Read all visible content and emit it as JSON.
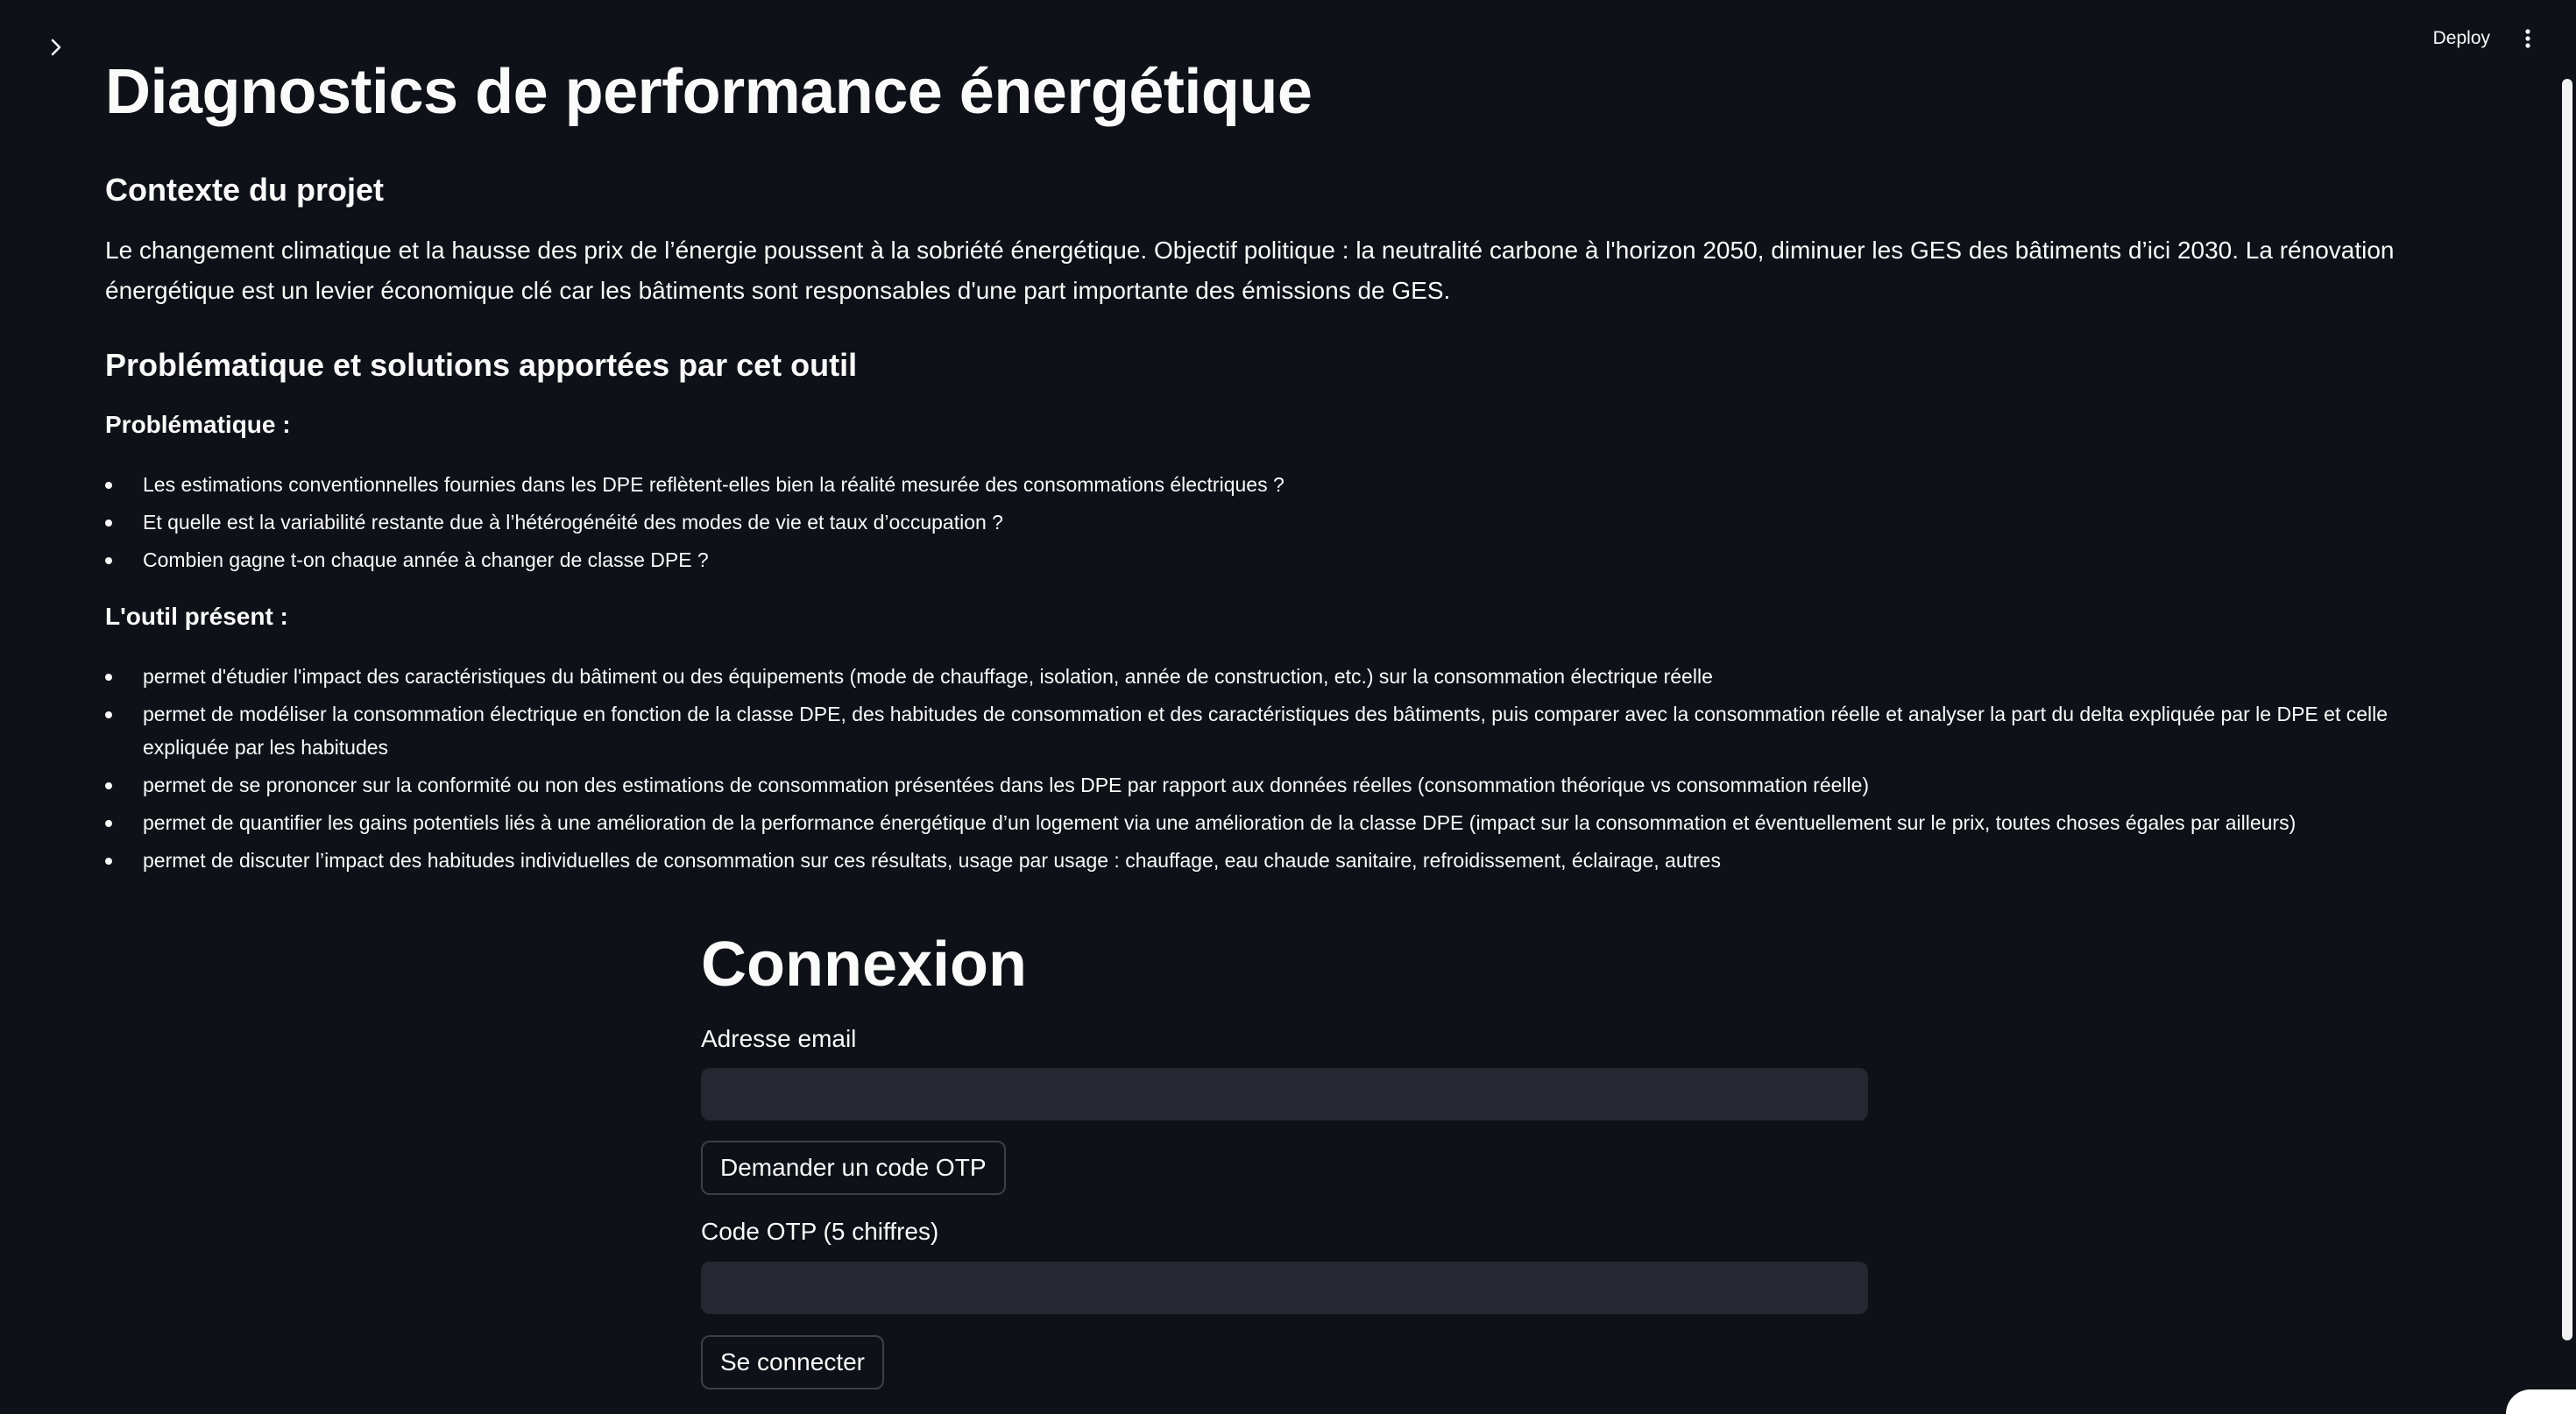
{
  "header": {
    "deploy_label": "Deploy"
  },
  "page": {
    "title": "Diagnostics de performance énergétique"
  },
  "context": {
    "heading": "Contexte du projet",
    "paragraph": "Le changement climatique et la hausse des prix de l’énergie poussent à la sobriété énergétique. Objectif politique : la neutralité carbone à l'horizon 2050, diminuer les GES des bâtiments d’ici 2030. La rénovation énergétique est un levier économique clé car les bâtiments sont responsables d'une part importante des émissions de GES."
  },
  "problem": {
    "heading": "Problématique et solutions apportées par cet outil",
    "label": "Problématique :",
    "items": [
      "Les estimations conventionnelles fournies dans les DPE reflètent-elles bien la réalité mesurée des consommations électriques ?",
      "Et quelle est la variabilité restante due à l’hétérogénéité des modes de vie et taux d’occupation ?",
      "Combien gagne t-on chaque année à changer de classe DPE ?"
    ]
  },
  "tool": {
    "label": "L'outil présent :",
    "items": [
      "permet d'étudier l'impact des caractéristiques du bâtiment ou des équipements (mode de chauffage, isolation, année de construction, etc.) sur la consommation électrique réelle",
      "permet de modéliser la consommation électrique en fonction de la classe DPE, des habitudes de consommation et des caractéristiques des bâtiments, puis comparer avec la consommation réelle et analyser la part du delta expliquée par le DPE et celle expliquée par les habitudes",
      "permet de se prononcer sur la conformité ou non des estimations de consommation présentées dans les DPE par rapport aux données réelles (consommation théorique vs consommation réelle)",
      "permet de quantifier les gains potentiels liés à une amélioration de la performance énergétique d’un logement via une amélioration de la classe DPE (impact sur la consommation et éventuellement sur le prix, toutes choses égales par ailleurs)",
      "permet de discuter l’impact des habitudes individuelles de consommation sur ces résultats, usage par usage : chauffage, eau chaude sanitaire, refroidissement, éclairage, autres"
    ]
  },
  "login": {
    "title": "Connexion",
    "email_label": "Adresse email",
    "email_value": "",
    "request_otp_label": "Demander un code OTP",
    "otp_label": "Code OTP (5 chiffres)",
    "otp_value": "",
    "submit_label": "Se connecter"
  },
  "icons": {
    "sidebar_toggle": "chevron-right-icon",
    "menu": "kebab-menu-icon"
  },
  "colors": {
    "background": "#0e1117",
    "input_background": "#262730",
    "text": "#fafafa"
  }
}
